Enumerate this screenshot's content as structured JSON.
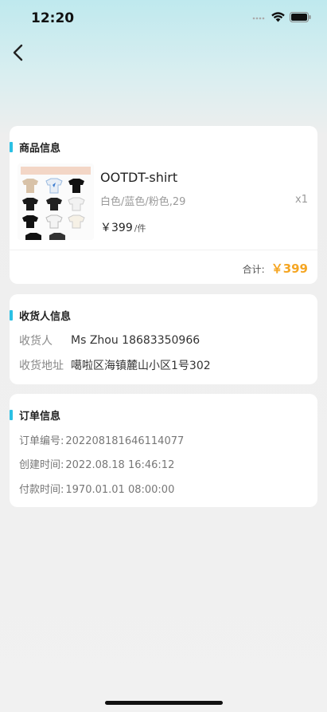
{
  "status_bar": {
    "time": "12:20"
  },
  "goods": {
    "section_title": "商品信息",
    "name": "OOTDT-shirt",
    "spec": "白色/蓝色/粉色,29",
    "qty": "x1",
    "price": "￥399",
    "unit": "/件",
    "total_label": "合计:",
    "total_value": "￥399"
  },
  "receiver": {
    "section_title": "收货人信息",
    "name_label": "收货人",
    "name_value": "Ms Zhou 18683350966",
    "address_label": "收货地址",
    "address_value": "噶啦区海镇麓山小区1号302"
  },
  "order": {
    "section_title": "订单信息",
    "number_label": "订单编号:",
    "number_value": "202208181646114077",
    "created_label": "创建时间:",
    "created_value": "2022.08.18 16:46:12",
    "paid_label": "付款时间:",
    "paid_value": "1970.01.01 08:00:00"
  },
  "colors": {
    "accent": "#2bc0e4",
    "price": "#f5a623"
  },
  "icons": {
    "back": "chevron-left-icon",
    "wifi": "wifi-icon",
    "battery": "battery-icon",
    "signal": "signal-icon"
  }
}
